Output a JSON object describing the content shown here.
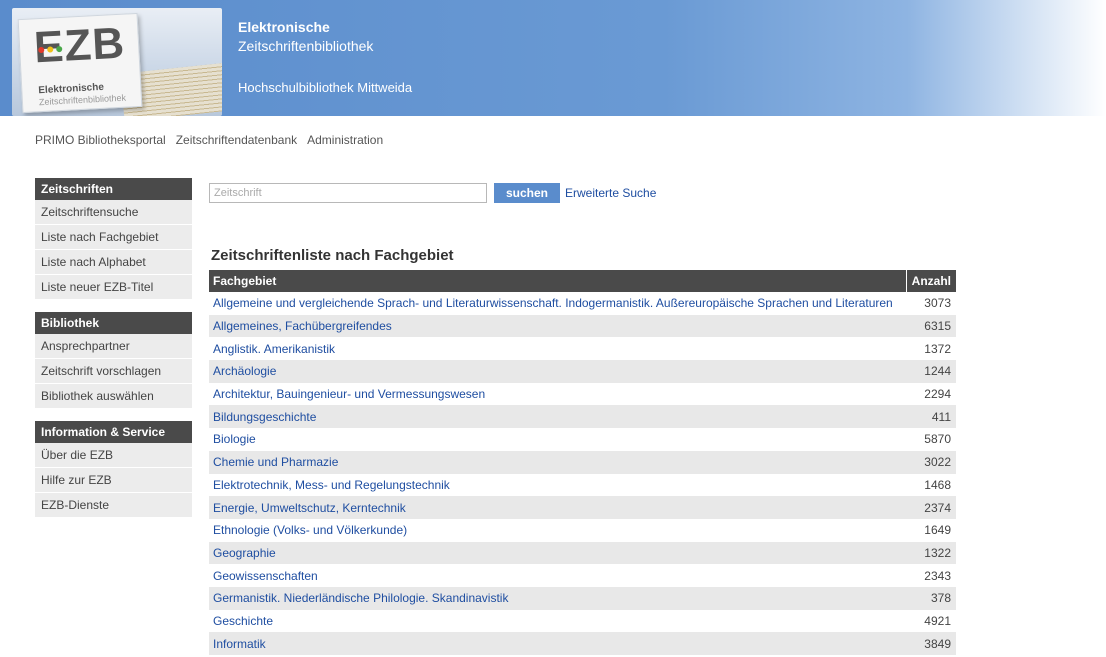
{
  "header": {
    "logo_text": "EZB",
    "logo_sub1": "Elektronische",
    "logo_sub2": "Zeitschriftenbibliothek",
    "title_line1": "Elektronische",
    "title_line2": "Zeitschriftenbibliothek",
    "library": "Hochschulbibliothek Mittweida"
  },
  "topnav": [
    "PRIMO Bibliotheksportal",
    "Zeitschriftendatenbank",
    "Administration"
  ],
  "sidebar": [
    {
      "heading": "Zeitschriften",
      "items": [
        "Zeitschriftensuche",
        "Liste nach Fachgebiet",
        "Liste nach Alphabet",
        "Liste neuer EZB-Titel"
      ]
    },
    {
      "heading": "Bibliothek",
      "items": [
        "Ansprechpartner",
        "Zeitschrift vorschlagen",
        "Bibliothek auswählen"
      ]
    },
    {
      "heading": "Information & Service",
      "items": [
        "Über die EZB",
        "Hilfe zur EZB",
        "EZB-Dienste"
      ]
    }
  ],
  "search": {
    "placeholder": "Zeitschrift",
    "button": "suchen",
    "advanced": "Erweiterte Suche"
  },
  "list": {
    "title": "Zeitschriftenliste nach Fachgebiet",
    "col_subject": "Fachgebiet",
    "col_count": "Anzahl",
    "rows": [
      {
        "name": "Allgemeine und vergleichende Sprach- und Literaturwissenschaft. Indogermanistik. Außereuropäische Sprachen und Literaturen",
        "count": "3073"
      },
      {
        "name": "Allgemeines, Fachübergreifendes",
        "count": "6315"
      },
      {
        "name": "Anglistik. Amerikanistik",
        "count": "1372"
      },
      {
        "name": "Archäologie",
        "count": "1244"
      },
      {
        "name": "Architektur, Bauingenieur- und Vermessungswesen",
        "count": "2294"
      },
      {
        "name": "Bildungsgeschichte",
        "count": "411"
      },
      {
        "name": "Biologie",
        "count": "5870"
      },
      {
        "name": "Chemie und Pharmazie",
        "count": "3022"
      },
      {
        "name": "Elektrotechnik, Mess- und Regelungstechnik",
        "count": "1468"
      },
      {
        "name": "Energie, Umweltschutz, Kerntechnik",
        "count": "2374"
      },
      {
        "name": "Ethnologie (Volks- und Völkerkunde)",
        "count": "1649"
      },
      {
        "name": "Geographie",
        "count": "1322"
      },
      {
        "name": "Geowissenschaften",
        "count": "2343"
      },
      {
        "name": "Germanistik. Niederländische Philologie. Skandinavistik",
        "count": "378"
      },
      {
        "name": "Geschichte",
        "count": "4921"
      },
      {
        "name": "Informatik",
        "count": "3849"
      }
    ]
  }
}
